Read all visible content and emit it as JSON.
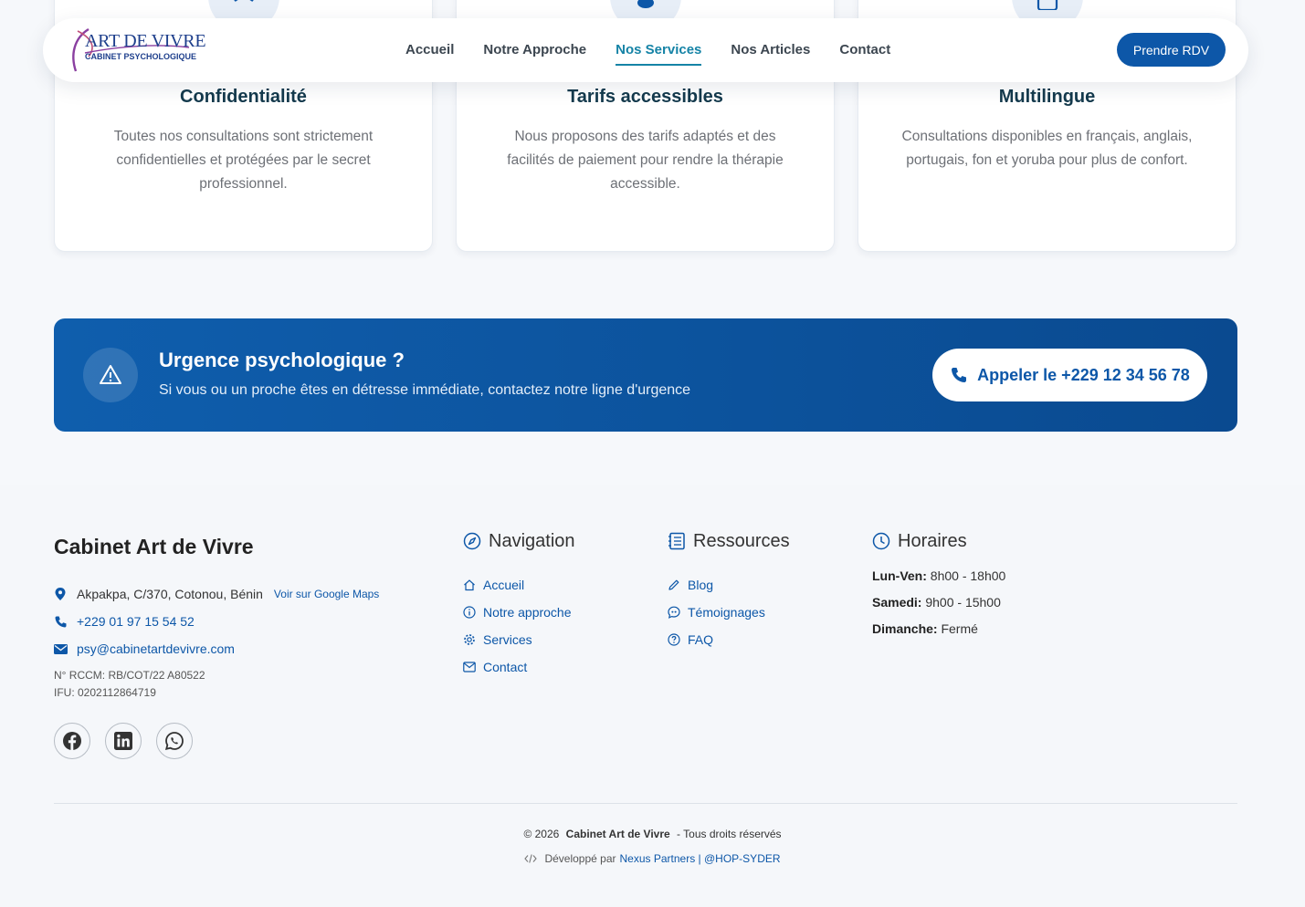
{
  "header": {
    "logo_main": "ART DE VIVRE",
    "logo_sub": "CABINET PSYCHOLOGIQUE",
    "nav": [
      "Accueil",
      "Notre Approche",
      "Nos Services",
      "Nos Articles",
      "Contact"
    ],
    "active_nav": "Nos Services",
    "cta_label": "Prendre RDV"
  },
  "features": [
    {
      "title": "Confidentialité",
      "icon": "shield-icon",
      "text": "Toutes nos consultations sont strictement confidentielles et protégées par le secret professionnel."
    },
    {
      "title": "Tarifs accessibles",
      "icon": "coin-icon",
      "text": "Nous proposons des tarifs adaptés et des facilités de paiement pour rendre la thérapie accessible."
    },
    {
      "title": "Multilingue",
      "icon": "language-icon",
      "text": "Consultations disponibles en français, anglais, portugais, fon et yoruba pour plus de confort."
    }
  ],
  "emergency": {
    "title": "Urgence psychologique ?",
    "text": "Si vous ou un proche êtes en détresse immédiate, contactez notre ligne d'urgence",
    "button_label": "Appeler le +229 12 34 56 78"
  },
  "footer": {
    "brand": "Cabinet Art de Vivre",
    "address": "Akpakpa, C/370, Cotonou, Bénin",
    "maps_link": "Voir sur Google Maps",
    "phone": "+229 01 97 15 54 52",
    "email": "psy@cabinetartdevivre.com",
    "rccm": "N° RCCM: RB/COT/22 A80522",
    "ifu": "IFU: 0202112864719",
    "socials": [
      "facebook-icon",
      "linkedin-icon",
      "whatsapp-icon"
    ],
    "navigation": {
      "title": "Navigation",
      "items": [
        "Accueil",
        "Notre approche",
        "Services",
        "Contact"
      ]
    },
    "resources": {
      "title": "Ressources",
      "items": [
        "Blog",
        "Témoignages",
        "FAQ"
      ]
    },
    "hours": {
      "title": "Horaires",
      "rows": [
        {
          "day": "Lun-Ven:",
          "time": "8h00 - 18h00"
        },
        {
          "day": "Samedi:",
          "time": "9h00 - 15h00"
        },
        {
          "day": "Dimanche:",
          "time": "Fermé"
        }
      ]
    },
    "copyright_prefix": "© 2026",
    "copyright_brand": "Cabinet Art de Vivre",
    "copyright_suffix": "- Tous droits réservés",
    "credit_prefix": "Développé par",
    "credit_link": "Nexus Partners | @HOP-SYDER"
  },
  "colors": {
    "primary": "#0d57a8",
    "teal_active": "#1583a6",
    "heading": "#143a4d",
    "background": "#f6f8fb"
  }
}
